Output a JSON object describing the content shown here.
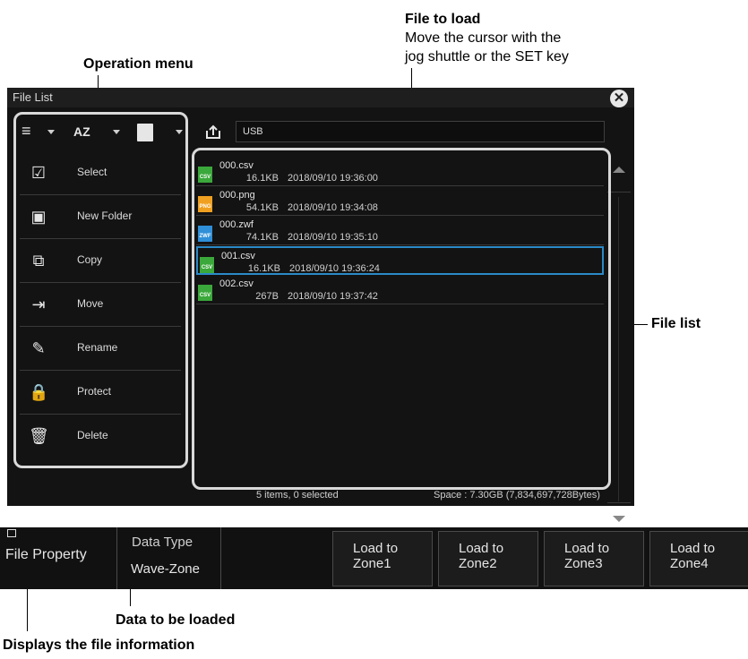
{
  "annotations": {
    "operation_menu": "Operation menu",
    "file_to_load_title": "File to load",
    "file_to_load_line1": "Move the cursor with the",
    "file_to_load_line2": "jog shuttle or the SET key",
    "file_list": "File list",
    "data_to_be_loaded": "Data to be loaded",
    "displays_file_info": "Displays the file information"
  },
  "window": {
    "title": "File List",
    "close_glyph": "✕"
  },
  "toolbar": {
    "sort_label": "AZ",
    "path": "USB"
  },
  "menu": [
    {
      "label": "Select",
      "icon": "select-checkbox-icon",
      "glyph": "☑"
    },
    {
      "label": "New Folder",
      "icon": "new-folder-icon",
      "glyph": "▣"
    },
    {
      "label": "Copy",
      "icon": "copy-icon",
      "glyph": "⧉"
    },
    {
      "label": "Move",
      "icon": "move-icon",
      "glyph": "⇥"
    },
    {
      "label": "Rename",
      "icon": "pencil-icon",
      "glyph": "✎"
    },
    {
      "label": "Protect",
      "icon": "lock-icon",
      "glyph": "🔒"
    },
    {
      "label": "Delete",
      "icon": "trash-icon",
      "glyph": "🗑"
    }
  ],
  "files": [
    {
      "name": "000.csv",
      "size": "16.1KB",
      "date": "2018/09/10 19:36:00",
      "badge": "CSV",
      "badge_color": "#3ba83b",
      "selected": false
    },
    {
      "name": "000.png",
      "size": "54.1KB",
      "date": "2018/09/10 19:34:08",
      "badge": "PNG",
      "badge_color": "#f0a020",
      "selected": false
    },
    {
      "name": "000.zwf",
      "size": "74.1KB",
      "date": "2018/09/10 19:35:10",
      "badge": "ZWF",
      "badge_color": "#2f8fd8",
      "selected": false
    },
    {
      "name": "001.csv",
      "size": "16.1KB",
      "date": "2018/09/10 19:36:24",
      "badge": "CSV",
      "badge_color": "#3ba83b",
      "selected": true
    },
    {
      "name": "002.csv",
      "size": "267B",
      "date": "2018/09/10 19:37:42",
      "badge": "CSV",
      "badge_color": "#3ba83b",
      "selected": false
    }
  ],
  "status": {
    "items": "5 items, 0 selected",
    "space": "Space : 7.30GB (7,834,697,728Bytes)"
  },
  "softkeys": {
    "file_property": "File Property",
    "data_type_label": "Data Type",
    "data_type_value": "Wave-Zone",
    "load": [
      {
        "line1": "Load to",
        "line2": "Zone1"
      },
      {
        "line1": "Load to",
        "line2": "Zone2"
      },
      {
        "line1": "Load to",
        "line2": "Zone3"
      },
      {
        "line1": "Load to",
        "line2": "Zone4"
      }
    ]
  },
  "colors": {
    "selection_border": "#2b8ac8",
    "bracket": "#d9d9d9",
    "panel_bg": "#131313"
  }
}
